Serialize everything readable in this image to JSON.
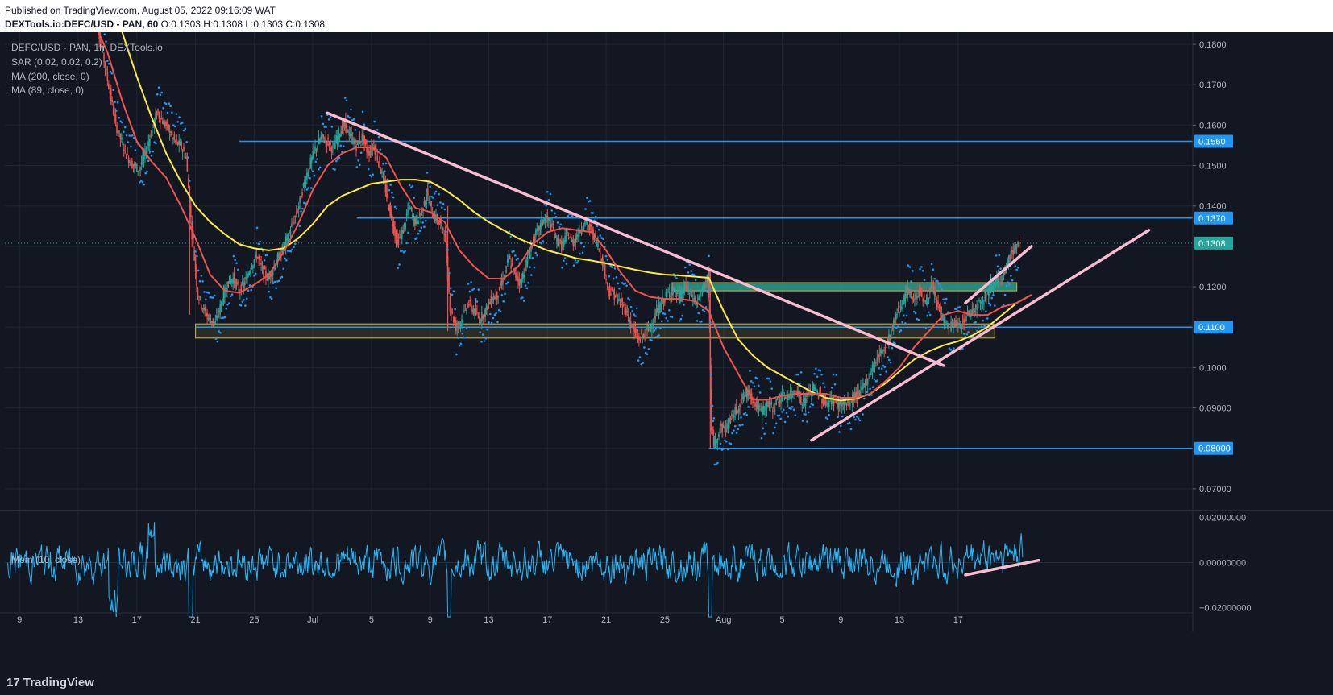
{
  "header": {
    "published": "Published on TradingView.com, August 05, 2022 09:16:09 WAT",
    "symbol_full": "DEXTools.io:DEFC/USD - PAN, 60",
    "ohlc": "O:0.1303 H:0.1308 L:0.1303 C:0.1308"
  },
  "legend": {
    "symbol": "DEFC/USD - PAN, 1h, DEXTools.io",
    "sar": "SAR (0.02, 0.02, 0.2)",
    "ma200": "MA (200, close, 0)",
    "ma89": "MA (89, close, 0)",
    "mom": "Mom (10, close)"
  },
  "footer": {
    "brand": "TradingView"
  },
  "colors": {
    "background": "#131722",
    "candle_up": "#26a69a",
    "candle_down": "#ef5350",
    "sar": "#2196f3",
    "ma200": "#ffeb3b",
    "ma89": "#ef5350",
    "trendline": "#f8bbd0",
    "hline": "#2196f3",
    "zone_fill": "#2a9d8f",
    "zone_border": "#b5a642",
    "mom": "#29b6f6",
    "last_price": "#26a69a"
  },
  "chart_data": {
    "type": "candlestick",
    "timeframe": "1h",
    "x_tick_labels": [
      "9",
      "13",
      "17",
      "21",
      "25",
      "Jul",
      "5",
      "9",
      "13",
      "17",
      "21",
      "25",
      "Aug",
      "5",
      "9",
      "13",
      "17"
    ],
    "price_axis": {
      "ylim": [
        0.065,
        0.183
      ],
      "ticks": [
        "0.1800",
        "0.1700",
        "0.1600",
        "0.1500",
        "0.1400",
        "0.1200",
        "0.1000",
        "0.09000",
        "0.07000"
      ]
    },
    "horizontal_levels": [
      {
        "label": "0.1560",
        "value": 0.156
      },
      {
        "label": "0.1370",
        "value": 0.137
      },
      {
        "label": "0.1100",
        "value": 0.11
      },
      {
        "label": "0.08000",
        "value": 0.08
      }
    ],
    "last_price": {
      "label": "0.1308",
      "value": 0.1308
    },
    "price_path": [
      [
        6.0,
        0.19
      ],
      [
        6.4,
        0.184
      ],
      [
        6.8,
        0.176
      ],
      [
        7.2,
        0.168
      ],
      [
        7.6,
        0.16
      ],
      [
        8.0,
        0.156
      ],
      [
        8.4,
        0.152
      ],
      [
        8.8,
        0.15
      ],
      [
        9.2,
        0.149
      ],
      [
        9.6,
        0.153
      ],
      [
        10.0,
        0.158
      ],
      [
        10.4,
        0.163
      ],
      [
        10.8,
        0.161
      ],
      [
        11.2,
        0.159
      ],
      [
        11.6,
        0.156
      ],
      [
        12.0,
        0.155
      ],
      [
        12.4,
        0.152
      ],
      [
        12.8,
        0.133
      ],
      [
        13.2,
        0.118
      ],
      [
        13.6,
        0.114
      ],
      [
        14.0,
        0.112
      ],
      [
        14.4,
        0.111
      ],
      [
        14.8,
        0.116
      ],
      [
        15.2,
        0.121
      ],
      [
        15.6,
        0.122
      ],
      [
        16.0,
        0.119
      ],
      [
        16.4,
        0.121
      ],
      [
        16.8,
        0.125
      ],
      [
        17.2,
        0.128
      ],
      [
        17.6,
        0.124
      ],
      [
        18.0,
        0.122
      ],
      [
        18.4,
        0.125
      ],
      [
        18.8,
        0.128
      ],
      [
        19.2,
        0.131
      ],
      [
        19.6,
        0.135
      ],
      [
        20.0,
        0.139
      ],
      [
        20.4,
        0.145
      ],
      [
        20.8,
        0.15
      ],
      [
        21.2,
        0.154
      ],
      [
        21.6,
        0.157
      ],
      [
        22.0,
        0.156
      ],
      [
        22.4,
        0.154
      ],
      [
        22.8,
        0.158
      ],
      [
        23.2,
        0.16
      ],
      [
        23.6,
        0.157
      ],
      [
        24.0,
        0.155
      ],
      [
        24.4,
        0.157
      ],
      [
        24.8,
        0.153
      ],
      [
        25.2,
        0.155
      ],
      [
        25.6,
        0.15
      ],
      [
        26.0,
        0.144
      ],
      [
        26.4,
        0.137
      ],
      [
        26.8,
        0.131
      ],
      [
        27.2,
        0.134
      ],
      [
        27.6,
        0.14
      ],
      [
        28.0,
        0.136
      ],
      [
        28.4,
        0.138
      ],
      [
        28.8,
        0.143
      ],
      [
        29.2,
        0.138
      ],
      [
        29.6,
        0.136
      ],
      [
        30.0,
        0.134
      ],
      [
        30.4,
        0.115
      ],
      [
        30.8,
        0.11
      ],
      [
        31.2,
        0.112
      ],
      [
        31.6,
        0.116
      ],
      [
        32.0,
        0.114
      ],
      [
        32.4,
        0.112
      ],
      [
        32.8,
        0.114
      ],
      [
        33.2,
        0.117
      ],
      [
        33.6,
        0.118
      ],
      [
        34.0,
        0.122
      ],
      [
        34.4,
        0.127
      ],
      [
        34.8,
        0.123
      ],
      [
        35.2,
        0.121
      ],
      [
        35.6,
        0.126
      ],
      [
        36.0,
        0.131
      ],
      [
        36.4,
        0.134
      ],
      [
        36.8,
        0.137
      ],
      [
        37.2,
        0.136
      ],
      [
        37.6,
        0.132
      ],
      [
        38.0,
        0.13
      ],
      [
        38.4,
        0.133
      ],
      [
        38.8,
        0.131
      ],
      [
        39.2,
        0.134
      ],
      [
        39.6,
        0.136
      ],
      [
        40.0,
        0.134
      ],
      [
        40.4,
        0.131
      ],
      [
        40.8,
        0.126
      ],
      [
        41.2,
        0.119
      ],
      [
        41.6,
        0.118
      ],
      [
        42.0,
        0.116
      ],
      [
        42.4,
        0.114
      ],
      [
        42.8,
        0.11
      ],
      [
        43.2,
        0.107
      ],
      [
        43.6,
        0.108
      ],
      [
        44.0,
        0.11
      ],
      [
        44.4,
        0.113
      ],
      [
        44.8,
        0.116
      ],
      [
        45.2,
        0.118
      ],
      [
        45.6,
        0.119
      ],
      [
        46.0,
        0.117
      ],
      [
        46.4,
        0.12
      ],
      [
        46.8,
        0.118
      ],
      [
        47.2,
        0.116
      ],
      [
        47.6,
        0.119
      ],
      [
        48.0,
        0.124
      ],
      [
        48.2,
        0.085
      ],
      [
        48.4,
        0.081
      ],
      [
        48.8,
        0.085
      ],
      [
        49.2,
        0.085
      ],
      [
        49.6,
        0.088
      ],
      [
        50.0,
        0.09
      ],
      [
        50.4,
        0.093
      ],
      [
        50.8,
        0.094
      ],
      [
        51.2,
        0.091
      ],
      [
        51.6,
        0.089
      ],
      [
        52.0,
        0.091
      ],
      [
        52.4,
        0.09
      ],
      [
        52.8,
        0.092
      ],
      [
        53.2,
        0.093
      ],
      [
        53.6,
        0.093
      ],
      [
        54.0,
        0.095
      ],
      [
        54.4,
        0.091
      ],
      [
        54.8,
        0.093
      ],
      [
        55.2,
        0.095
      ],
      [
        55.6,
        0.093
      ],
      [
        56.0,
        0.091
      ],
      [
        56.4,
        0.092
      ],
      [
        56.8,
        0.091
      ],
      [
        57.2,
        0.091
      ],
      [
        57.6,
        0.091
      ],
      [
        58.0,
        0.093
      ],
      [
        58.4,
        0.094
      ],
      [
        58.8,
        0.097
      ],
      [
        59.2,
        0.1
      ],
      [
        59.6,
        0.103
      ],
      [
        60.0,
        0.105
      ],
      [
        60.4,
        0.108
      ],
      [
        60.8,
        0.113
      ],
      [
        61.2,
        0.116
      ],
      [
        61.6,
        0.119
      ],
      [
        62.0,
        0.117
      ],
      [
        62.4,
        0.119
      ],
      [
        62.8,
        0.116
      ],
      [
        63.2,
        0.12
      ],
      [
        63.6,
        0.116
      ],
      [
        64.0,
        0.112
      ],
      [
        64.4,
        0.11
      ],
      [
        64.8,
        0.111
      ],
      [
        65.2,
        0.11
      ],
      [
        65.6,
        0.113
      ],
      [
        66.0,
        0.114
      ],
      [
        66.4,
        0.116
      ],
      [
        66.8,
        0.117
      ],
      [
        67.2,
        0.12
      ],
      [
        67.6,
        0.122
      ],
      [
        68.0,
        0.121
      ],
      [
        68.4,
        0.126
      ],
      [
        68.8,
        0.129
      ],
      [
        69.2,
        0.1308
      ]
    ],
    "ma200_path": [
      [
        7.5,
        0.19
      ],
      [
        8.0,
        0.183
      ],
      [
        9.0,
        0.172
      ],
      [
        10.0,
        0.162
      ],
      [
        11.0,
        0.153
      ],
      [
        12.0,
        0.146
      ],
      [
        13.0,
        0.14
      ],
      [
        14.0,
        0.136
      ],
      [
        15.0,
        0.133
      ],
      [
        16.0,
        0.1305
      ],
      [
        17.0,
        0.1295
      ],
      [
        18.0,
        0.129
      ],
      [
        19.0,
        0.1295
      ],
      [
        20.0,
        0.132
      ],
      [
        21.0,
        0.1355
      ],
      [
        22.0,
        0.14
      ],
      [
        23.0,
        0.1425
      ],
      [
        24.0,
        0.144
      ],
      [
        25.0,
        0.1455
      ],
      [
        26.0,
        0.146
      ],
      [
        27.0,
        0.1465
      ],
      [
        28.0,
        0.1465
      ],
      [
        29.0,
        0.146
      ],
      [
        30.0,
        0.144
      ],
      [
        31.0,
        0.1415
      ],
      [
        32.0,
        0.1385
      ],
      [
        33.0,
        0.136
      ],
      [
        34.0,
        0.134
      ],
      [
        35.0,
        0.132
      ],
      [
        36.0,
        0.1305
      ],
      [
        37.0,
        0.129
      ],
      [
        38.0,
        0.128
      ],
      [
        39.0,
        0.127
      ],
      [
        40.0,
        0.1265
      ],
      [
        41.0,
        0.1258
      ],
      [
        42.0,
        0.125
      ],
      [
        43.0,
        0.1242
      ],
      [
        44.0,
        0.1235
      ],
      [
        45.0,
        0.123
      ],
      [
        46.0,
        0.1228
      ],
      [
        47.0,
        0.1225
      ],
      [
        48.0,
        0.1222
      ],
      [
        49.0,
        0.114
      ],
      [
        50.0,
        0.107
      ],
      [
        51.0,
        0.103
      ],
      [
        52.0,
        0.1
      ],
      [
        53.0,
        0.098
      ],
      [
        54.0,
        0.096
      ],
      [
        55.0,
        0.094
      ],
      [
        56.0,
        0.0925
      ],
      [
        57.0,
        0.0918
      ],
      [
        58.0,
        0.0923
      ],
      [
        59.0,
        0.0935
      ],
      [
        60.0,
        0.096
      ],
      [
        61.0,
        0.099
      ],
      [
        62.0,
        0.102
      ],
      [
        63.0,
        0.104
      ],
      [
        64.0,
        0.1055
      ],
      [
        65.0,
        0.1065
      ],
      [
        66.0,
        0.108
      ],
      [
        67.0,
        0.11
      ],
      [
        68.0,
        0.113
      ],
      [
        69.0,
        0.116
      ],
      [
        70.0,
        0.118
      ]
    ],
    "ma89_path": [
      [
        6.0,
        0.186
      ],
      [
        7.0,
        0.178
      ],
      [
        8.0,
        0.166
      ],
      [
        9.0,
        0.156
      ],
      [
        10.0,
        0.151
      ],
      [
        11.0,
        0.147
      ],
      [
        12.0,
        0.14
      ],
      [
        13.0,
        0.132
      ],
      [
        14.0,
        0.123
      ],
      [
        15.0,
        0.119
      ],
      [
        16.0,
        0.1185
      ],
      [
        17.0,
        0.1205
      ],
      [
        18.0,
        0.123
      ],
      [
        19.0,
        0.1285
      ],
      [
        20.0,
        0.1355
      ],
      [
        21.0,
        0.144
      ],
      [
        22.0,
        0.15
      ],
      [
        23.0,
        0.153
      ],
      [
        24.0,
        0.1545
      ],
      [
        25.0,
        0.1545
      ],
      [
        26.0,
        0.152
      ],
      [
        27.0,
        0.145
      ],
      [
        28.0,
        0.1395
      ],
      [
        29.0,
        0.1385
      ],
      [
        30.0,
        0.136
      ],
      [
        31.0,
        0.129
      ],
      [
        32.0,
        0.125
      ],
      [
        33.0,
        0.122
      ],
      [
        34.0,
        0.122
      ],
      [
        35.0,
        0.125
      ],
      [
        36.0,
        0.1305
      ],
      [
        37.0,
        0.1335
      ],
      [
        38.0,
        0.1345
      ],
      [
        39.0,
        0.134
      ],
      [
        40.0,
        0.1335
      ],
      [
        41.0,
        0.129
      ],
      [
        42.0,
        0.1235
      ],
      [
        43.0,
        0.119
      ],
      [
        44.0,
        0.1175
      ],
      [
        45.0,
        0.117
      ],
      [
        46.0,
        0.117
      ],
      [
        47.0,
        0.1165
      ],
      [
        48.0,
        0.114
      ],
      [
        49.0,
        0.105
      ],
      [
        50.0,
        0.0985
      ],
      [
        51.0,
        0.092
      ],
      [
        52.0,
        0.092
      ],
      [
        53.0,
        0.093
      ],
      [
        54.0,
        0.0935
      ],
      [
        55.0,
        0.0935
      ],
      [
        56.0,
        0.0935
      ],
      [
        57.0,
        0.0925
      ],
      [
        58.0,
        0.0925
      ],
      [
        59.0,
        0.0935
      ],
      [
        60.0,
        0.0965
      ],
      [
        61.0,
        0.1
      ],
      [
        62.0,
        0.105
      ],
      [
        63.0,
        0.109
      ],
      [
        64.0,
        0.113
      ],
      [
        65.0,
        0.114
      ],
      [
        66.0,
        0.113
      ],
      [
        67.0,
        0.113
      ],
      [
        68.0,
        0.115
      ],
      [
        69.0,
        0.116
      ],
      [
        70.0,
        0.118
      ]
    ],
    "trendlines": [
      {
        "x1": 22.0,
        "y1": 0.163,
        "x2": 64.0,
        "y2": 0.1005
      },
      {
        "x1": 55.0,
        "y1": 0.082,
        "x2": 78.0,
        "y2": 0.134
      },
      {
        "x1": 65.5,
        "y1": 0.116,
        "x2": 70.0,
        "y2": 0.13
      }
    ],
    "zones": [
      {
        "x1": 13.0,
        "x2": 67.5,
        "y1": 0.1073,
        "y2": 0.1108
      },
      {
        "x1": 45.5,
        "x2": 69.0,
        "y1": 0.119,
        "y2": 0.121
      }
    ],
    "momentum": {
      "ylim": [
        -0.022,
        0.022
      ],
      "ticks": [
        "0.02000000",
        "0.00000000",
        "−0.02000000"
      ],
      "trendline": {
        "x1": 65.5,
        "y1": -0.0055,
        "x2": 70.5,
        "y2": 0.001
      }
    }
  }
}
